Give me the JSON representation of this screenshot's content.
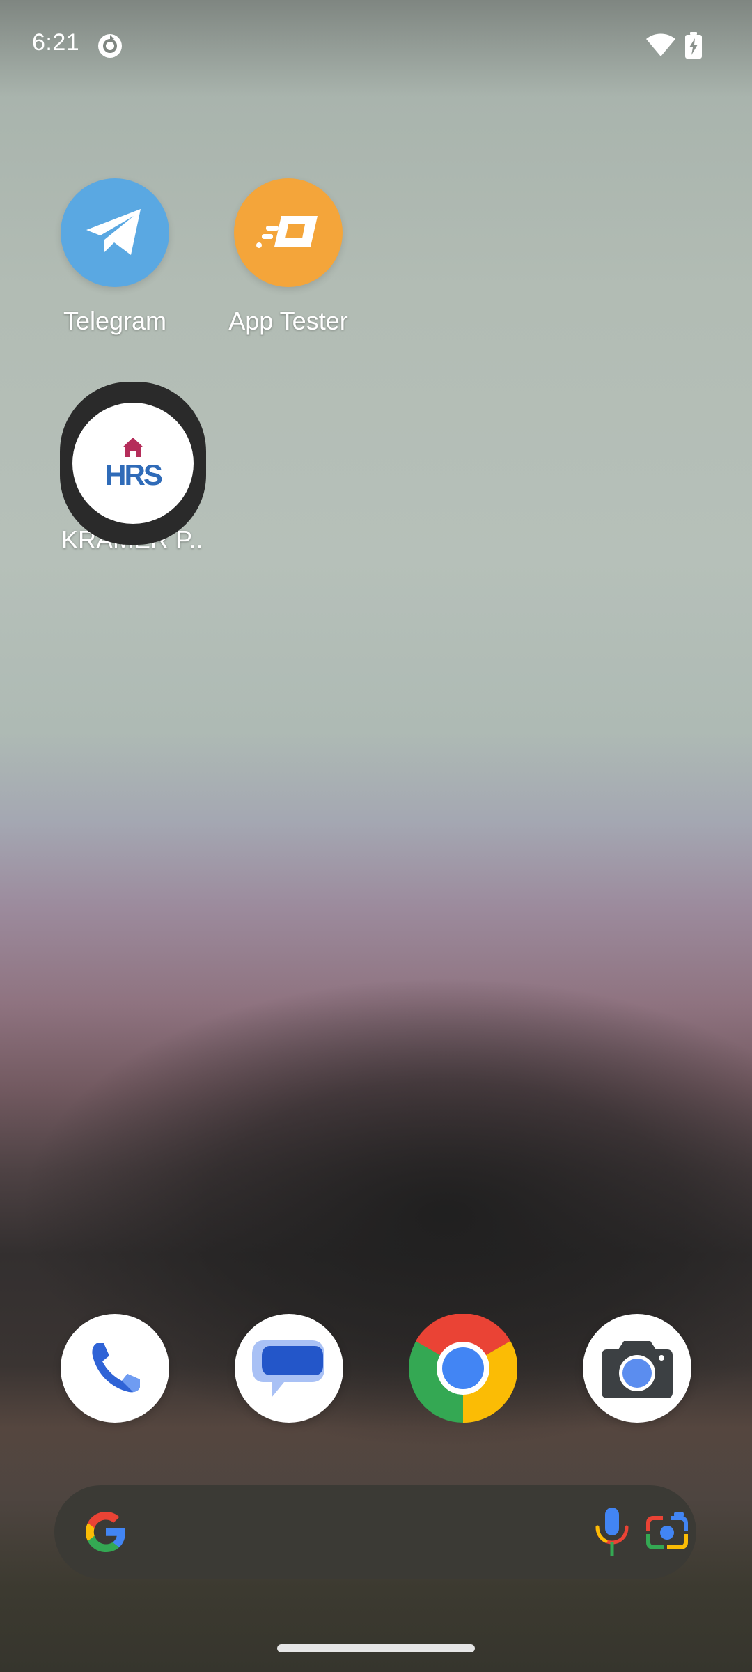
{
  "status_bar": {
    "time": "6:21",
    "notification_icon": "sync-app-icon",
    "wifi_icon": "wifi-icon",
    "battery_icon": "battery-charging-icon"
  },
  "home_apps": [
    {
      "label": "Telegram",
      "icon": "telegram-icon",
      "color": "#5aa8e2"
    },
    {
      "label": "App Tester",
      "icon": "app-tester-icon",
      "color": "#f4a53a"
    },
    {
      "label": "KRAMER P..",
      "icon": "hrs-icon"
    }
  ],
  "hrs_logo_text": "HRS",
  "dock": [
    {
      "name": "Phone",
      "icon": "phone-icon"
    },
    {
      "name": "Messages",
      "icon": "messages-icon"
    },
    {
      "name": "Chrome",
      "icon": "chrome-icon"
    },
    {
      "name": "Camera",
      "icon": "camera-icon"
    }
  ],
  "search": {
    "google_icon": "google-g-icon",
    "mic_icon": "mic-icon",
    "lens_icon": "lens-icon"
  },
  "colors": {
    "telegram": "#5aa8e2",
    "app_tester": "#f4a53a",
    "google_blue": "#4285f4",
    "google_red": "#ea4335",
    "google_yellow": "#fbbc05",
    "google_green": "#34a853"
  }
}
